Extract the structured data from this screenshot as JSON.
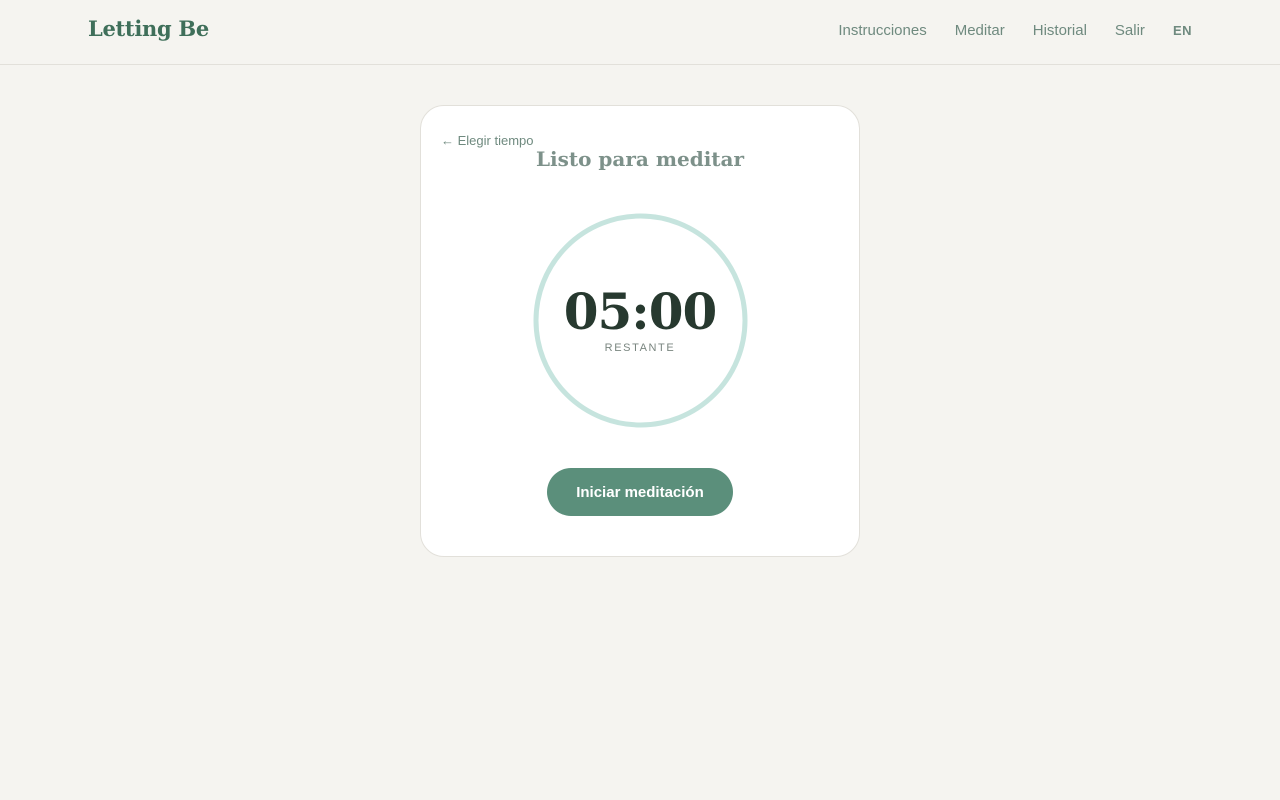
{
  "header": {
    "logo": "Letting Be",
    "nav": {
      "instructions": "Instrucciones",
      "meditate": "Meditar",
      "history": "Historial",
      "logout": "Salir",
      "language": "EN"
    }
  },
  "card": {
    "back_link": "← Elegir tiempo",
    "title": "Listo para meditar",
    "timer": {
      "time": "05:00",
      "label": "RESTANTE",
      "progress": 0
    },
    "start_button": "Iniciar meditación"
  },
  "colors": {
    "background": "#f5f4f0",
    "brand": "#3f6f5a",
    "button": "#5b8f7b",
    "ring": "#c6e4de",
    "time_text": "#27392f"
  }
}
